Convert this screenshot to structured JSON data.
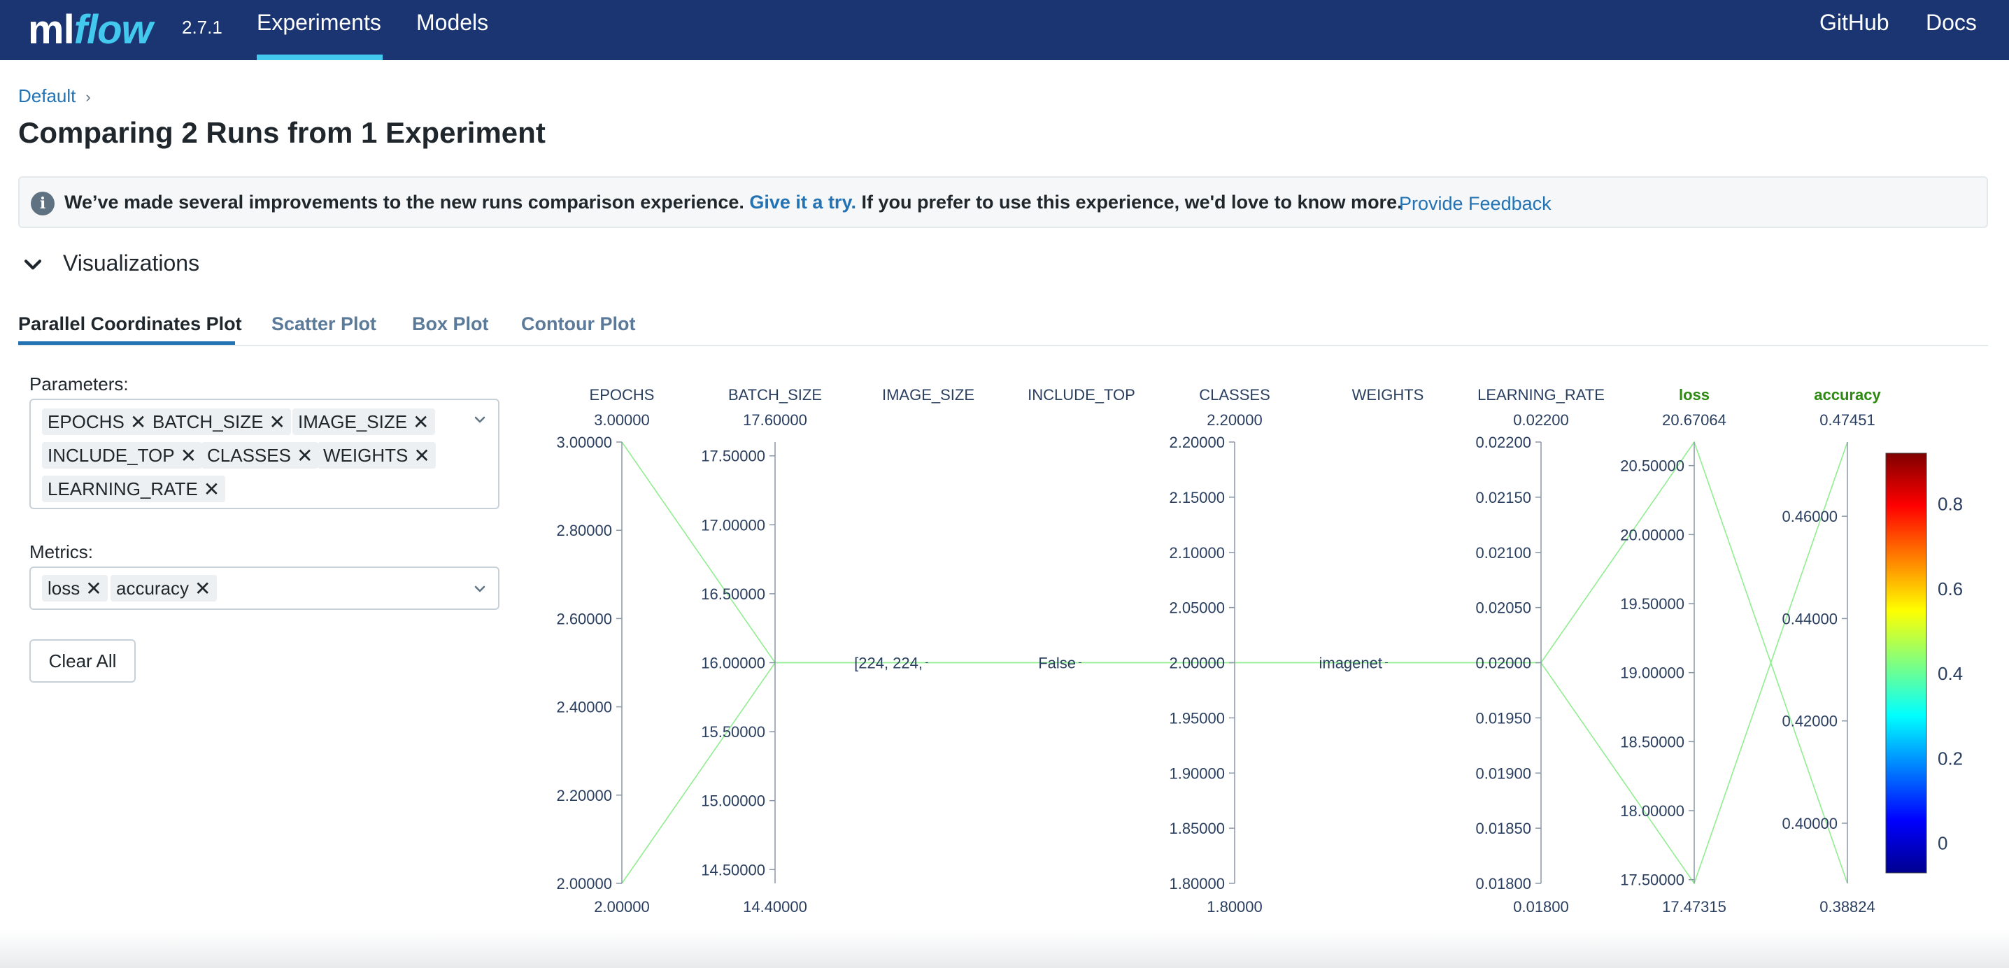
{
  "header": {
    "logo_ml": "ml",
    "logo_flow": "flow",
    "version": "2.7.1",
    "nav": [
      "Experiments",
      "Models"
    ],
    "links": [
      "GitHub",
      "Docs"
    ]
  },
  "breadcrumb": {
    "item": "Default",
    "separator": "›"
  },
  "page_title": "Comparing 2 Runs from 1 Experiment",
  "banner": {
    "text_before": "We’ve made several improvements to the new runs comparison experience.",
    "link": "Give it a try.",
    "text_after": "If you prefer to use this experience, we'd love to know more.",
    "feedback": "Provide Feedback"
  },
  "visualizations": {
    "title": "Visualizations"
  },
  "tabs": [
    "Parallel Coordinates Plot",
    "Scatter Plot",
    "Box Plot",
    "Contour Plot"
  ],
  "parameters": {
    "label": "Parameters:",
    "tags": [
      "EPOCHS",
      "BATCH_SIZE",
      "IMAGE_SIZE",
      "INCLUDE_TOP",
      "CLASSES",
      "WEIGHTS",
      "LEARNING_RATE"
    ]
  },
  "metrics": {
    "label": "Metrics:",
    "tags": [
      "loss",
      "accuracy"
    ]
  },
  "clear_all": "Clear All",
  "chart_data": {
    "type": "parallel_coordinates",
    "axes": [
      {
        "name": "EPOCHS",
        "kind": "param",
        "top": "3.00000",
        "bottom": "2.00000",
        "ticks": [
          "3.00000",
          "2.80000",
          "2.60000",
          "2.40000",
          "2.20000",
          "2.00000"
        ],
        "tick_values": [
          3.0,
          2.8,
          2.6,
          2.4,
          2.2,
          2.0
        ],
        "range": [
          2.0,
          3.0
        ]
      },
      {
        "name": "BATCH_SIZE",
        "kind": "param",
        "top": "17.60000",
        "bottom": "14.40000",
        "ticks": [
          "17.50000",
          "17.00000",
          "16.50000",
          "16.00000",
          "15.50000",
          "15.00000",
          "14.50000"
        ],
        "tick_values": [
          17.5,
          17.0,
          16.5,
          16.0,
          15.5,
          15.0,
          14.5
        ],
        "range": [
          14.4,
          17.6
        ]
      },
      {
        "name": "IMAGE_SIZE",
        "kind": "param",
        "top": "",
        "bottom": "",
        "ticks": [
          "[224, 224,"
        ],
        "categorical": true
      },
      {
        "name": "INCLUDE_TOP",
        "kind": "param",
        "top": "",
        "bottom": "",
        "ticks": [
          "False"
        ],
        "categorical": true
      },
      {
        "name": "CLASSES",
        "kind": "param",
        "top": "2.20000",
        "bottom": "1.80000",
        "ticks": [
          "2.20000",
          "2.15000",
          "2.10000",
          "2.05000",
          "2.00000",
          "1.95000",
          "1.90000",
          "1.85000",
          "1.80000"
        ],
        "tick_values": [
          2.2,
          2.15,
          2.1,
          2.05,
          2.0,
          1.95,
          1.9,
          1.85,
          1.8
        ],
        "range": [
          1.8,
          2.2
        ]
      },
      {
        "name": "WEIGHTS",
        "kind": "param",
        "top": "",
        "bottom": "",
        "ticks": [
          "imagenet"
        ],
        "categorical": true
      },
      {
        "name": "LEARNING_RATE",
        "kind": "param",
        "top": "0.02200",
        "bottom": "0.01800",
        "ticks": [
          "0.02200",
          "0.02150",
          "0.02100",
          "0.02050",
          "0.02000",
          "0.01950",
          "0.01900",
          "0.01850",
          "0.01800"
        ],
        "tick_values": [
          0.022,
          0.0215,
          0.021,
          0.0205,
          0.02,
          0.0195,
          0.019,
          0.0185,
          0.018
        ],
        "range": [
          0.018,
          0.022
        ]
      },
      {
        "name": "loss",
        "kind": "metric",
        "top": "20.67064",
        "bottom": "17.47315",
        "ticks": [
          "20.50000",
          "20.00000",
          "19.50000",
          "19.00000",
          "18.50000",
          "18.00000",
          "17.50000"
        ],
        "tick_values": [
          20.5,
          20.0,
          19.5,
          19.0,
          18.5,
          18.0,
          17.5
        ],
        "range": [
          17.47315,
          20.67064
        ]
      },
      {
        "name": "accuracy",
        "kind": "metric",
        "top": "0.47451",
        "bottom": "0.38824",
        "ticks": [
          "0.46000",
          "0.44000",
          "0.42000",
          "0.40000"
        ],
        "tick_values": [
          0.46,
          0.44,
          0.42,
          0.4
        ],
        "range": [
          0.38824,
          0.47451
        ]
      }
    ],
    "runs": [
      {
        "EPOCHS": 3,
        "BATCH_SIZE": 16,
        "IMAGE_SIZE": "[224, 224,",
        "INCLUDE_TOP": "False",
        "CLASSES": 2,
        "WEIGHTS": "imagenet",
        "LEARNING_RATE": 0.02,
        "loss": 20.67064,
        "accuracy": 0.38824
      },
      {
        "EPOCHS": 2,
        "BATCH_SIZE": 16,
        "IMAGE_SIZE": "[224, 224,",
        "INCLUDE_TOP": "False",
        "CLASSES": 2,
        "WEIGHTS": "imagenet",
        "LEARNING_RATE": 0.02,
        "loss": 17.47315,
        "accuracy": 0.47451
      }
    ],
    "colorbar": {
      "ticks": [
        "0.8",
        "0.6",
        "0.4",
        "0.2",
        "0"
      ],
      "tick_values": [
        0.8,
        0.6,
        0.4,
        0.2,
        0
      ],
      "range": [
        -0.07,
        0.92
      ]
    },
    "line_color": "#90ee90"
  },
  "colors": {
    "header_bg": "#1a3571",
    "accent": "#43c9ed",
    "link": "#2272b4",
    "metric_title": "#2b8a0f"
  }
}
